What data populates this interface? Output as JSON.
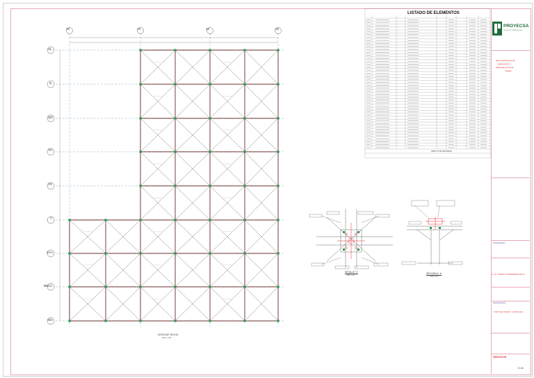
{
  "drawing": {
    "plan_title": "VISTA DE TECHO",
    "plan_scale": "ESC. 1:100",
    "detail_title": "DETALLE \"1\"",
    "detail_scale": "ESC. 1:10",
    "section_title": "SECCION A - A",
    "section_scale": "ESC. 1:10",
    "col_axes": [
      "10",
      "14",
      "15",
      "16"
    ],
    "row_axes": [
      "XL",
      "N",
      "QR",
      "TU",
      "VX",
      "Y",
      "ZAA",
      "BBCC",
      "DD"
    ]
  },
  "table": {
    "title": "LISTADO DE ELEMENTOS",
    "header": [
      "ITEM",
      "DESCRIPCION",
      "CANT.",
      "PERFIL",
      "LONG.",
      "PESO (Kg)",
      "",
      "AREA (m2)",
      ""
    ],
    "footer_label": "PESO TOTAL ESTIMADO",
    "rows": 44
  },
  "title_block": {
    "logo_text": "PROYECSA",
    "logo_sub": "PROYECTOS Y SERVICIOS S.A.",
    "project_lines": [
      "REGULARIZACION DE",
      "AMPLIACION Y",
      "REMODELACION DE",
      "TIENDA"
    ],
    "client_label": "PROPIETARIO",
    "client_name": "H. W. TIENDA SUPERMERCADOS",
    "drawing_desc_label": "DESCRIPCION",
    "drawing_desc": "VISTA DE TECHO - DETALLES",
    "location_label": "UBICACION",
    "sheet_code": "E-04"
  }
}
